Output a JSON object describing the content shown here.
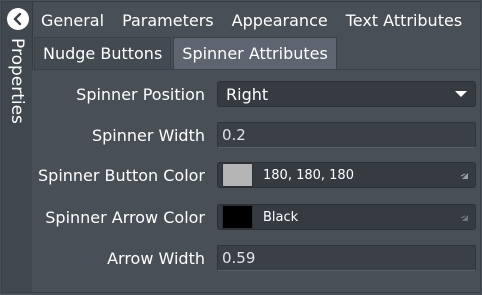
{
  "sidebar": {
    "title": "Properties"
  },
  "tabs_top": [
    "General",
    "Parameters",
    "Appearance",
    "Text Attributes"
  ],
  "tabs_sub": [
    {
      "label": "Nudge Buttons",
      "active": false
    },
    {
      "label": "Spinner Attributes",
      "active": true
    }
  ],
  "fields": {
    "spinner_position": {
      "label": "Spinner Position",
      "value": "Right"
    },
    "spinner_width": {
      "label": "Spinner Width",
      "value": "0.2"
    },
    "spinner_button_color": {
      "label": "Spinner Button Color",
      "value": "180, 180, 180",
      "swatch": "#b4b4b4"
    },
    "spinner_arrow_color": {
      "label": "Spinner Arrow Color",
      "value": "Black",
      "swatch": "#000000"
    },
    "arrow_width": {
      "label": "Arrow Width",
      "value": "0.59"
    }
  },
  "icons": {
    "back": "chevron-left-icon",
    "dropdown": "caret-down-icon",
    "corner": "corner-arrow-icon"
  }
}
